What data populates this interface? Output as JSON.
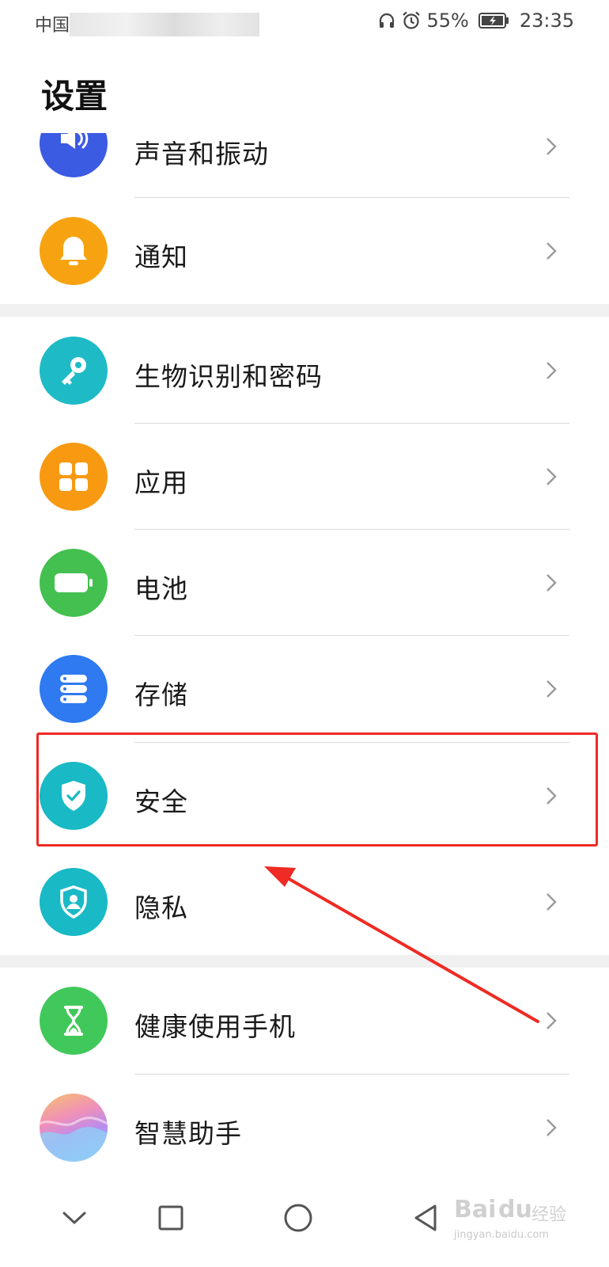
{
  "status_bar": {
    "carrier": "中国",
    "battery_percent": "55%",
    "time": "23:35",
    "icons": [
      "headset-icon",
      "alarm-icon",
      "battery-charging-icon"
    ]
  },
  "page": {
    "title": "设置"
  },
  "settings": {
    "items": [
      {
        "label": "声音和振动",
        "icon": "sound-icon",
        "color": "#3b5be3"
      },
      {
        "label": "通知",
        "icon": "bell-icon",
        "color": "#f7a311"
      },
      {
        "label": "生物识别和密码",
        "icon": "key-icon",
        "color": "#1ebbc7"
      },
      {
        "label": "应用",
        "icon": "apps-grid-icon",
        "color": "#f79a12"
      },
      {
        "label": "电池",
        "icon": "battery-icon",
        "color": "#43c04f"
      },
      {
        "label": "存储",
        "icon": "storage-icon",
        "color": "#2f7af1"
      },
      {
        "label": "安全",
        "icon": "shield-check-icon",
        "color": "#19b9c5"
      },
      {
        "label": "隐私",
        "icon": "privacy-shield-icon",
        "color": "#19b9c5"
      },
      {
        "label": "健康使用手机",
        "icon": "hourglass-icon",
        "color": "#41c85b"
      },
      {
        "label": "智慧助手",
        "icon": "assistant-icon",
        "color": "#c89bf0"
      }
    ]
  },
  "annotation": {
    "highlight_color": "#ee2b24",
    "highlighted_item": "安全"
  },
  "navbar": {
    "icons": [
      "hide-chevron-icon",
      "recents-icon",
      "home-icon",
      "back-icon"
    ]
  },
  "watermark": {
    "brand": "Bai",
    "brand_accent": "du",
    "suffix": "经验",
    "url": "jingyan.baidu.com"
  }
}
